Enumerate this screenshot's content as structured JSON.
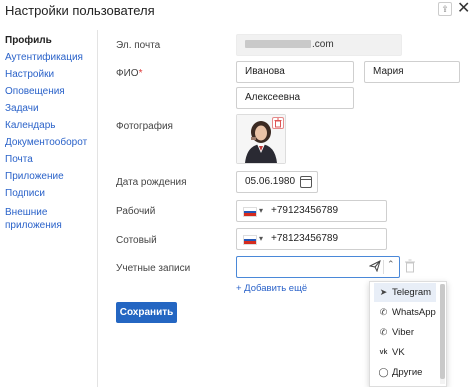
{
  "window": {
    "title": "Настройки пользователя",
    "pin_label": "⇪",
    "close_label": "✕"
  },
  "sidebar": {
    "items": [
      {
        "label": "Профиль",
        "active": true
      },
      {
        "label": "Аутентификация"
      },
      {
        "label": "Настройки"
      },
      {
        "label": "Оповещения"
      },
      {
        "label": "Задачи"
      },
      {
        "label": "Календарь"
      },
      {
        "label": "Документооборот"
      },
      {
        "label": "Почта"
      },
      {
        "label": "Приложение"
      },
      {
        "label": "Подписи"
      },
      {
        "label": "Внешние приложения",
        "line1": "Внешние",
        "line2": "приложения"
      }
    ]
  },
  "form": {
    "email": {
      "label": "Эл. почта",
      "value_suffix": "om"
    },
    "fio": {
      "label": "ФИО",
      "required_mark": "*",
      "last_name": "Иванова",
      "first_name": "Мария",
      "middle_name": "Алексеевна"
    },
    "photo": {
      "label": "Фотография"
    },
    "birth": {
      "label": "Дата рождения",
      "value": "05.06.1980"
    },
    "work_phone": {
      "label": "Рабочий",
      "caret": "▾",
      "value": "+79123456789"
    },
    "mobile_phone": {
      "label": "Сотовый",
      "caret": "▾",
      "value": "+78123456789"
    },
    "accounts": {
      "label": "Учетные записи",
      "caret": "⌃",
      "add_more": "+ Добавить ещё"
    },
    "save_label": "Сохранить"
  },
  "dropdown": {
    "options": [
      {
        "label": "Telegram",
        "icon": "telegram-icon",
        "glyph": "➤",
        "selected": true
      },
      {
        "label": "WhatsApp",
        "icon": "whatsapp-icon",
        "glyph": "✆"
      },
      {
        "label": "Viber",
        "icon": "viber-icon",
        "glyph": "✆"
      },
      {
        "label": "VK",
        "icon": "vk-icon",
        "glyph": "vk"
      },
      {
        "label": "Другие",
        "icon": "chat-bubble-icon",
        "glyph": "◯"
      }
    ]
  },
  "colors": {
    "link": "#2a62c9",
    "primary_button": "#2466c2",
    "focus_border": "#4a88d8",
    "required": "#dd3333",
    "flag_white": "#ffffff",
    "flag_blue": "#2457b6",
    "flag_red": "#d52b1e"
  }
}
